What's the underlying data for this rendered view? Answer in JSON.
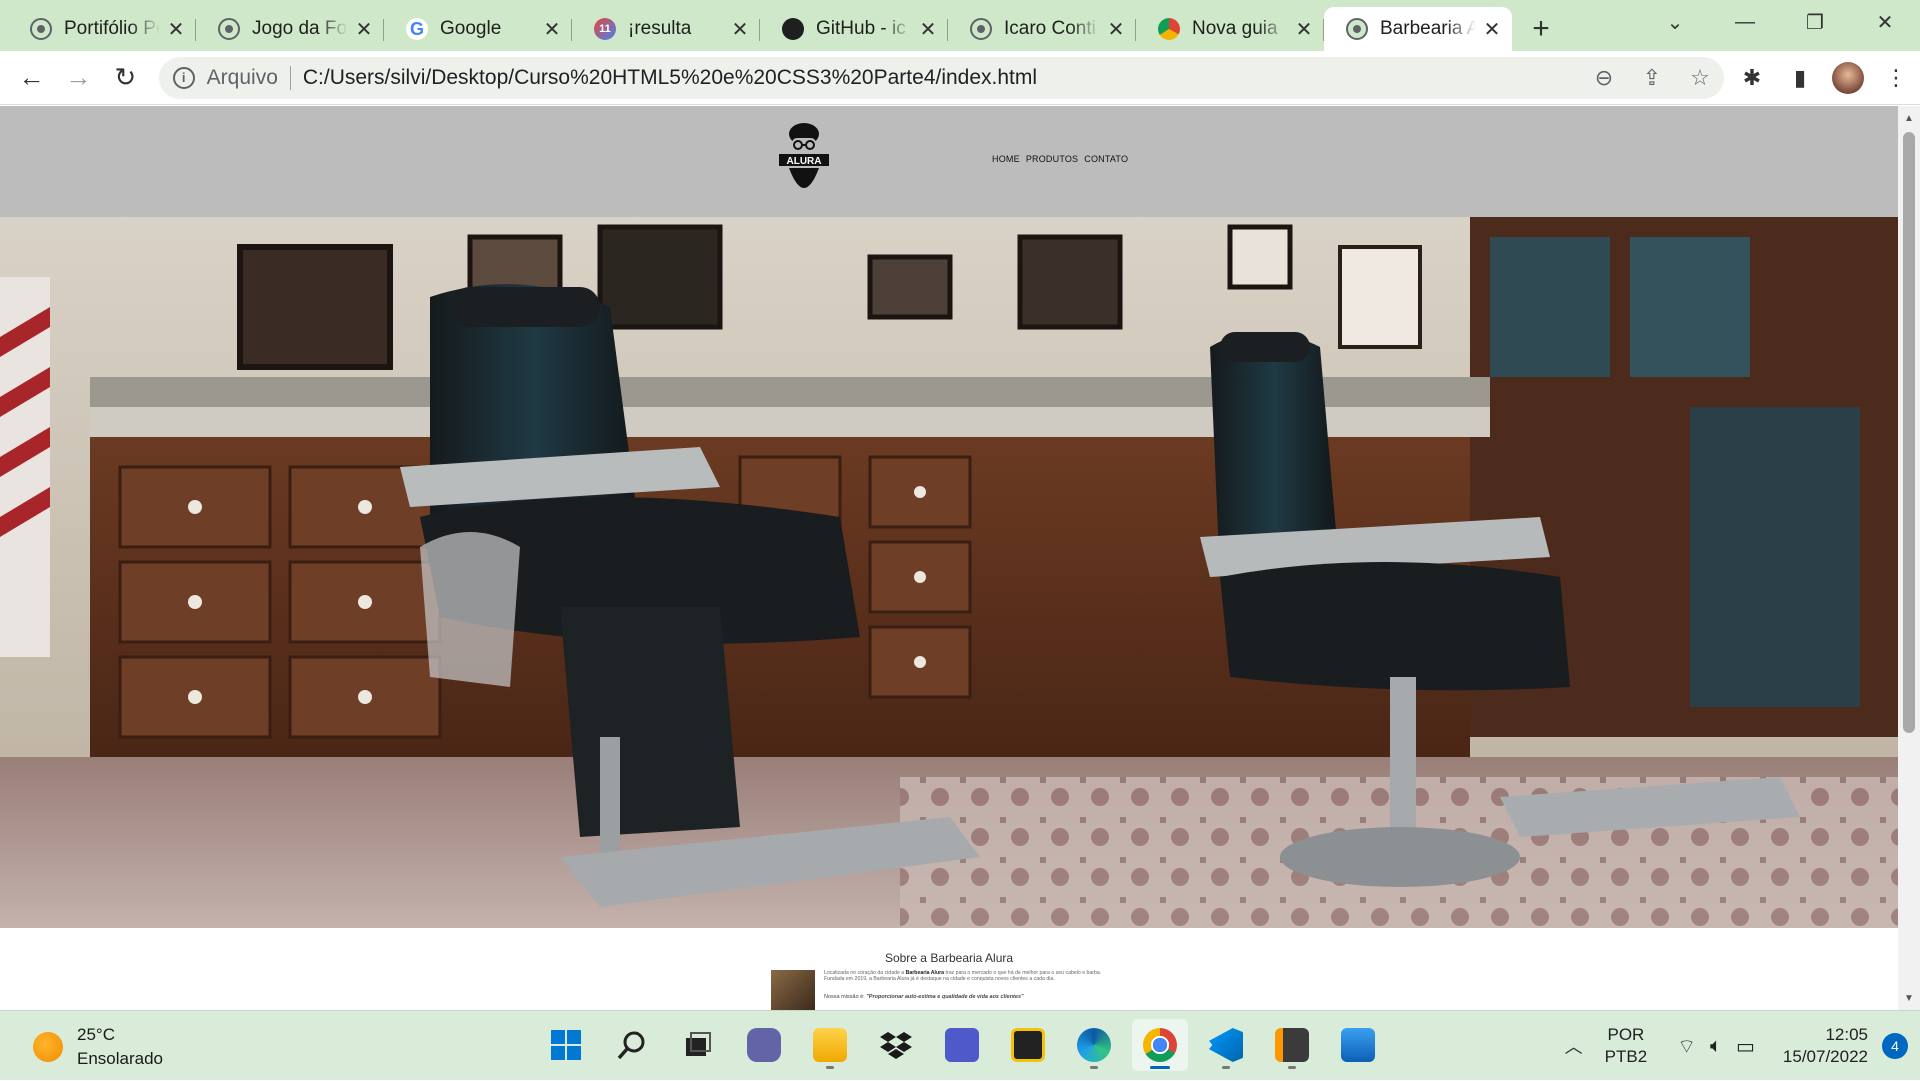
{
  "browser": {
    "tabs": [
      {
        "title": "Portifólio Pe",
        "icon": "globe-icon",
        "active": false
      },
      {
        "title": "Jogo da For",
        "icon": "globe-icon",
        "active": false
      },
      {
        "title": "Google",
        "icon": "google-icon",
        "active": false
      },
      {
        "title": "¡resulta",
        "icon": "multi-app-icon",
        "badge": "11",
        "active": false
      },
      {
        "title": "GitHub - ic",
        "icon": "github-icon",
        "active": false
      },
      {
        "title": "Icaro Conti",
        "icon": "globe-icon",
        "active": false
      },
      {
        "title": "Nova guia",
        "icon": "chrome-icon",
        "active": false
      },
      {
        "title": "Barbearia A",
        "icon": "globe-icon",
        "active": true
      }
    ],
    "new_tab_label": "+",
    "address": {
      "chip": "Arquivo",
      "url": "C:/Users/silvi/Desktop/Curso%20HTML5%20e%20CSS3%20Parte4/index.html"
    }
  },
  "site": {
    "logo_text": "ALURA",
    "nav": [
      "HOME",
      "PRODUTOS",
      "CONTATO"
    ],
    "about": {
      "title": "Sobre a Barbearia Alura",
      "paragraph_start": "Localizada no coração da cidade a ",
      "paragraph_bold": "Barbearia Alura",
      "paragraph_end": " traz para o mercado o que há de melhor para o seu cabelo e barba. Fundada em 2019, a Barbearia Alura já é destaque na cidade e conquista novos clientes a cada dia.",
      "mission_label": "Nossa missão é: ",
      "mission_quote": "\"Proporcionar auto-estima e qualidade de vida aos clientes\""
    }
  },
  "taskbar": {
    "weather_temp": "25°C",
    "weather_desc": "Ensolarado",
    "language_line1": "POR",
    "language_line2": "PTB2",
    "time": "12:05",
    "date": "15/07/2022",
    "notification_count": "4"
  },
  "colors": {
    "tab_strip": "#cfe8c9",
    "site_header": "#bcbcbc",
    "taskbar": "#d8ecd9",
    "accent": "#0067c0"
  }
}
